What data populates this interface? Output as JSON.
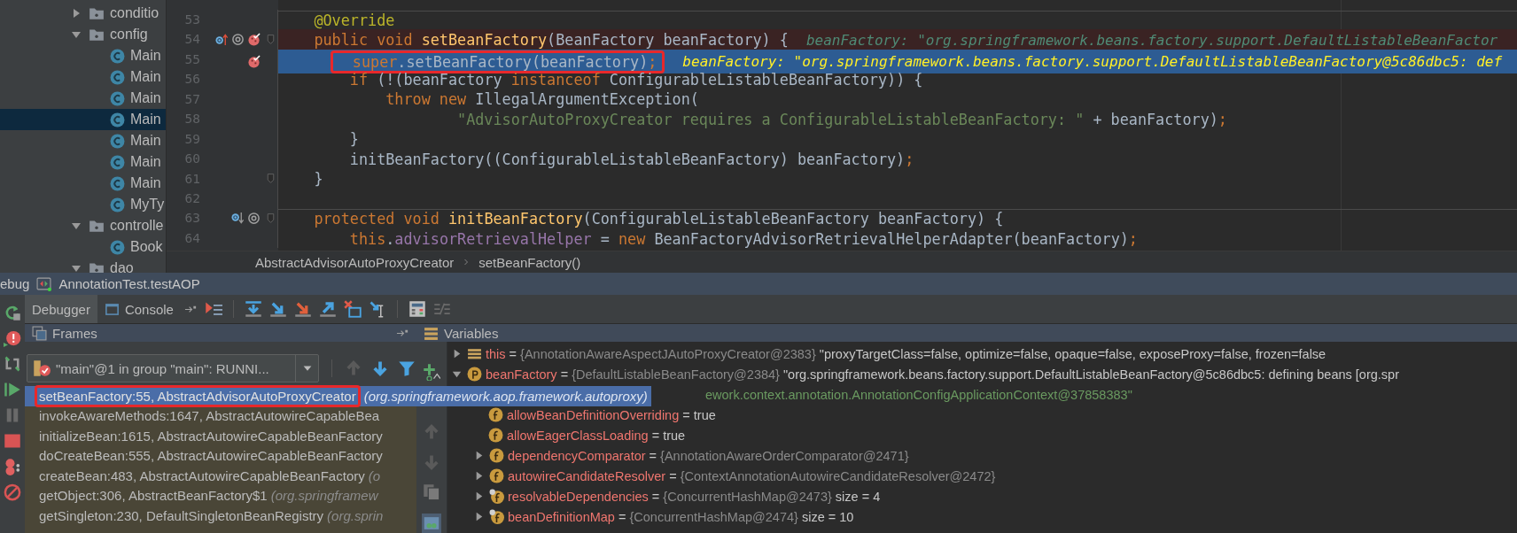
{
  "project_tree": {
    "items": [
      {
        "label": "conditio",
        "kind": "folder",
        "expanded": false,
        "selected": false
      },
      {
        "label": "config",
        "kind": "folder",
        "expanded": true,
        "selected": false,
        "children": [
          {
            "label": "Main",
            "kind": "class",
            "selected": false
          },
          {
            "label": "Main",
            "kind": "class",
            "selected": false
          },
          {
            "label": "Main",
            "kind": "class",
            "selected": false
          },
          {
            "label": "Main",
            "kind": "class",
            "selected": true
          },
          {
            "label": "Main",
            "kind": "class",
            "selected": false
          },
          {
            "label": "Main",
            "kind": "class",
            "selected": false
          },
          {
            "label": "Main",
            "kind": "class",
            "selected": false
          },
          {
            "label": "MyTy",
            "kind": "class",
            "selected": false
          }
        ]
      },
      {
        "label": "controlle",
        "kind": "folder",
        "expanded": true,
        "selected": false,
        "children": [
          {
            "label": "Book",
            "kind": "class",
            "selected": false
          }
        ]
      },
      {
        "label": "dao",
        "kind": "folder",
        "expanded": true,
        "selected": false
      }
    ]
  },
  "editor": {
    "lines": [
      {
        "number": "53",
        "separator": true,
        "fold": false,
        "breakpoint": false,
        "current": false,
        "boxed": false,
        "tokens": [
          {
            "kind": "ann",
            "t": "    @Override"
          }
        ]
      },
      {
        "number": "54",
        "separator": false,
        "fold": true,
        "breakpoint": true,
        "current": false,
        "boxed": false,
        "gutter": [
          {
            "kind": "overriding"
          },
          {
            "kind": "annotation"
          },
          {
            "kind": "breakpoint"
          }
        ],
        "tokens": [
          {
            "kind": "kw",
            "t": "    public void "
          },
          {
            "kind": "fn",
            "t": "setBeanFactory"
          },
          {
            "kind": "plain",
            "t": "(BeanFactory beanFactory) {"
          }
        ],
        "value": {
          "kind": "muted",
          "text": "beanFactory: \"org.springframework.beans.factory.support.DefaultListableBeanFactor"
        }
      },
      {
        "number": "55",
        "separator": false,
        "fold": false,
        "breakpoint": false,
        "current": true,
        "boxed": true,
        "gutter": [
          {
            "kind": "breakpoint"
          }
        ],
        "tokens": [
          {
            "kind": "kw",
            "t": "        super"
          },
          {
            "kind": "plain",
            "t": ".setBeanFactory(beanFactory)"
          },
          {
            "kind": "kw",
            "t": ";"
          }
        ],
        "value": {
          "kind": "current",
          "text": "beanFactory: \"org.springframework.beans.factory.support.DefaultListableBeanFactory@5c86dbc5: def"
        }
      },
      {
        "number": "56",
        "separator": false,
        "fold": false,
        "breakpoint": false,
        "current": false,
        "boxed": false,
        "tokens": [
          {
            "kind": "kw",
            "t": "        if "
          },
          {
            "kind": "plain",
            "t": "(!(beanFactory "
          },
          {
            "kind": "kw",
            "t": "instanceof "
          },
          {
            "kind": "plain",
            "t": "ConfigurableListableBeanFactory)) {"
          }
        ]
      },
      {
        "number": "57",
        "separator": false,
        "fold": false,
        "breakpoint": false,
        "current": false,
        "boxed": false,
        "tokens": [
          {
            "kind": "kw",
            "t": "            throw new "
          },
          {
            "kind": "plain",
            "t": "IllegalArgumentException("
          }
        ]
      },
      {
        "number": "58",
        "separator": false,
        "fold": false,
        "breakpoint": false,
        "current": false,
        "boxed": false,
        "tokens": [
          {
            "kind": "str",
            "t": "                    \"AdvisorAutoProxyCreator requires a ConfigurableListableBeanFactory: \""
          },
          {
            "kind": "plain",
            "t": " + beanFactory)"
          },
          {
            "kind": "kw",
            "t": ";"
          }
        ]
      },
      {
        "number": "59",
        "separator": false,
        "fold": false,
        "breakpoint": false,
        "current": false,
        "boxed": false,
        "tokens": [
          {
            "kind": "plain",
            "t": "        }"
          }
        ]
      },
      {
        "number": "60",
        "separator": false,
        "fold": false,
        "breakpoint": false,
        "current": false,
        "boxed": false,
        "tokens": [
          {
            "kind": "plain",
            "t": "        initBeanFactory((ConfigurableListableBeanFactory) beanFactory)"
          },
          {
            "kind": "kw",
            "t": ";"
          }
        ]
      },
      {
        "number": "61",
        "separator": false,
        "fold": true,
        "breakpoint": false,
        "current": false,
        "boxed": false,
        "tokens": [
          {
            "kind": "plain",
            "t": "    }"
          }
        ]
      },
      {
        "number": "62",
        "separator": false,
        "fold": false,
        "breakpoint": false,
        "current": false,
        "boxed": false
      },
      {
        "number": "63",
        "separator": true,
        "fold": true,
        "breakpoint": false,
        "current": false,
        "boxed": false,
        "gutter": [
          {
            "kind": "overridden"
          },
          {
            "kind": "annotation"
          }
        ],
        "tokens": [
          {
            "kind": "kw",
            "t": "    protected void "
          },
          {
            "kind": "fn",
            "t": "initBeanFactory"
          },
          {
            "kind": "plain",
            "t": "(ConfigurableListableBeanFactory beanFactory) {"
          }
        ]
      },
      {
        "number": "64",
        "separator": false,
        "fold": false,
        "breakpoint": false,
        "current": false,
        "boxed": false,
        "tokens": [
          {
            "kind": "kw",
            "t": "        this"
          },
          {
            "kind": "plain",
            "t": "."
          },
          {
            "kind": "field",
            "t": "advisorRetrievalHelper"
          },
          {
            "kind": "plain",
            "t": " = "
          },
          {
            "kind": "kw",
            "t": "new "
          },
          {
            "kind": "plain",
            "t": "BeanFactoryAdvisorRetrievalHelperAdapter(beanFactory)"
          },
          {
            "kind": "kw",
            "t": ";"
          }
        ]
      }
    ],
    "breadcrumb": [
      "AbstractAdvisorAutoProxyCreator",
      "setBeanFactory()"
    ]
  },
  "debug": {
    "title": "ebug",
    "run_config": "AnnotationTest.testAOP",
    "tabs": [
      {
        "label": "Debugger",
        "selected": true
      },
      {
        "label": "Console",
        "selected": false
      }
    ],
    "frames": {
      "title": "Frames",
      "thread": "\"main\"@1 in group \"main\": RUNNI...",
      "rows": [
        {
          "method": "setBeanFactory:55, AbstractAdvisorAutoProxyCreator",
          "package": "(org.springframework.aop.framework.autoproxy)",
          "selected": true,
          "boxed": true
        },
        {
          "method": "invokeAwareMethods:1647, AbstractAutowireCapableBea",
          "selected": false,
          "boxed": false
        },
        {
          "method": "initializeBean:1615, AbstractAutowireCapableBeanFactory",
          "selected": false,
          "boxed": false
        },
        {
          "method": "doCreateBean:555, AbstractAutowireCapableBeanFactory",
          "selected": false,
          "boxed": false
        },
        {
          "method": "createBean:483, AbstractAutowireCapableBeanFactory",
          "package": "(o",
          "selected": false,
          "boxed": false
        },
        {
          "method": "getObject:306, AbstractBeanFactory$1",
          "package": "(org.springframew",
          "selected": false,
          "boxed": false
        },
        {
          "method": "getSingleton:230, DefaultSingletonBeanRegistry",
          "package": "(org.sprin",
          "selected": false,
          "boxed": false
        }
      ]
    },
    "variables": {
      "title": "Variables",
      "rows": [
        {
          "kind": "this",
          "final": false,
          "name": "this",
          "equals": "=",
          "ref": "{AnnotationAwareAspectJAutoProxyCreator@2383}",
          "value": "\"proxyTargetClass=false, optimize=false, opaque=false, exposeProxy=false, frozen=false",
          "expandable": true,
          "expanded": false
        },
        {
          "kind": "param",
          "final": false,
          "name": "beanFactory",
          "equals": "=",
          "ref": "{DefaultListableBeanFactory@2384}",
          "value": "\"org.springframework.beans.factory.support.DefaultListableBeanFactory@5c86dbc5: defining beans [org.spr",
          "continuation": "ework.context.annotation.AnnotationConfigApplicationContext@37858383\"",
          "expandable": true,
          "expanded": true,
          "children": [
            {
              "kind": "field",
              "final": false,
              "name": "allowBeanDefinitionOverriding",
              "equals": "=",
              "value": "true",
              "expandable": false
            },
            {
              "kind": "field",
              "final": false,
              "name": "allowEagerClassLoading",
              "equals": "=",
              "value": "true",
              "expandable": false
            },
            {
              "kind": "field",
              "final": false,
              "name": "dependencyComparator",
              "equals": "=",
              "ref": "{AnnotationAwareOrderComparator@2471}",
              "expandable": true,
              "expanded": false
            },
            {
              "kind": "field",
              "final": false,
              "name": "autowireCandidateResolver",
              "equals": "=",
              "ref": "{ContextAnnotationAutowireCandidateResolver@2472}",
              "expandable": true,
              "expanded": false
            },
            {
              "kind": "field",
              "final": true,
              "name": "resolvableDependencies",
              "equals": "=",
              "ref": "{ConcurrentHashMap@2473}",
              "value": "size = 4",
              "expandable": true,
              "expanded": false
            },
            {
              "kind": "field",
              "final": true,
              "name": "beanDefinitionMap",
              "equals": "=",
              "ref": "{ConcurrentHashMap@2474}",
              "value": "size = 10",
              "expandable": true,
              "expanded": false
            }
          ]
        }
      ]
    }
  }
}
